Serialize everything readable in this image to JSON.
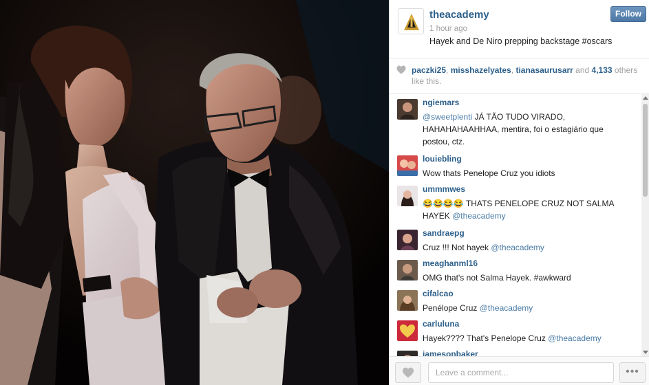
{
  "post": {
    "username": "theacademy",
    "timestamp": "1 hour ago",
    "caption": "Hayek and De Niro prepping backstage #oscars",
    "follow_label": "Follow"
  },
  "likes": {
    "users": [
      "paczki25",
      "misshazelyates",
      "tianasaurusarr"
    ],
    "sep1": ", ",
    "sep2": ", ",
    "and_text": " and ",
    "count": "4,133",
    "suffix": " others like this."
  },
  "comments": [
    {
      "user": "ngiemars",
      "mention": "@sweetplenti",
      "text": " JÁ TÃO TUDO VIRADO, HAHAHAHAAHHAA, mentira, foi o estagiário que postou, ctz."
    },
    {
      "user": "louiebling",
      "text": "Wow thats Penelope Cruz you idiots"
    },
    {
      "user": "ummmwes",
      "text": "😂😂😂😂 THATS PENELOPE CRUZ NOT SALMA HAYEK ",
      "mention": "@theacademy"
    },
    {
      "user": "sandraepg",
      "text": "Cruz !!! Not hayek ",
      "mention": "@theacademy"
    },
    {
      "user": "meaghanml16",
      "text": "OMG that's not Salma Hayek. #awkward"
    },
    {
      "user": "cifalcao",
      "text": "Penélope Cruz ",
      "mention": "@theacademy"
    },
    {
      "user": "carluluna",
      "text": "Hayek???? That's Penelope Cruz ",
      "mention": "@theacademy"
    },
    {
      "user": "jamesonbaker",
      "text": ""
    }
  ],
  "footer": {
    "comment_placeholder": "Leave a comment...",
    "more_label": "•••"
  },
  "icons": {
    "logo": "oscar-statuette-icon",
    "likes": "heart-icon",
    "like_button": "heart-icon",
    "more": "ellipsis-icon"
  },
  "colors": {
    "username": "#2c5f8a",
    "mention": "#4a7ba6",
    "follow_button": "#5b84b1",
    "muted": "#a0a0a0"
  }
}
